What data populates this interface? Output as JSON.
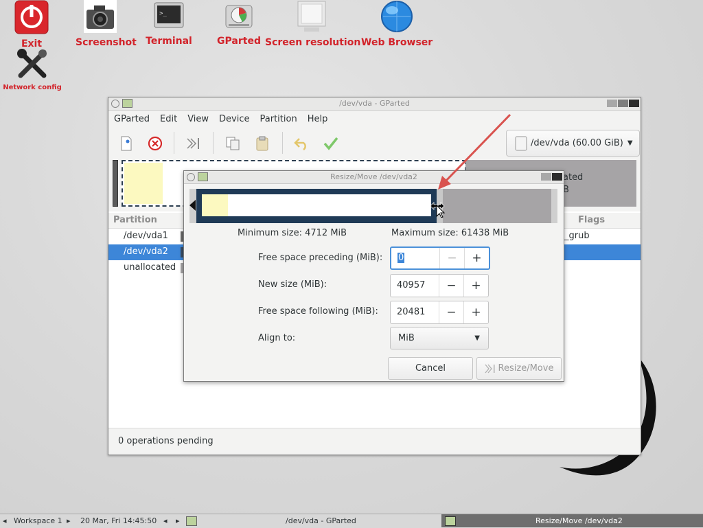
{
  "desktop": {
    "icons": [
      {
        "label": "Exit",
        "icon": "power-icon"
      },
      {
        "label": "Screenshot",
        "icon": "camera-icon"
      },
      {
        "label": "Terminal",
        "icon": "terminal-icon"
      },
      {
        "label": "GParted",
        "icon": "disk-icon"
      },
      {
        "label": "Screen resolution",
        "icon": "monitor-icon"
      },
      {
        "label": "Web Browser",
        "icon": "globe-icon"
      },
      {
        "label": "Network config",
        "icon": "tools-icon"
      }
    ]
  },
  "main_window": {
    "title": "/dev/vda - GParted",
    "menu": [
      "GParted",
      "Edit",
      "View",
      "Device",
      "Partition",
      "Help"
    ],
    "device_selector": "/dev/vda (60.00 GiB)",
    "disk_map_partial_label": "ated",
    "disk_map_partial_size": "B",
    "columns": {
      "partition": "Partition",
      "flags": "Flags"
    },
    "rows": [
      {
        "name": "/dev/vda1",
        "flags": "_grub",
        "selected": false
      },
      {
        "name": "/dev/vda2",
        "flags": "",
        "selected": true
      },
      {
        "name": "unallocated",
        "flags": "",
        "selected": false
      }
    ],
    "status": "0 operations pending"
  },
  "dialog": {
    "title": "Resize/Move /dev/vda2",
    "min_size": "Minimum size: 4712 MiB",
    "max_size": "Maximum size: 61438 MiB",
    "fields": [
      {
        "label": "Free space preceding (MiB):",
        "value": "0"
      },
      {
        "label": "New size (MiB):",
        "value": "40957"
      },
      {
        "label": "Free space following (MiB):",
        "value": "20481"
      }
    ],
    "align_label": "Align to:",
    "align_value": "MiB",
    "cancel": "Cancel",
    "resize_move": "Resize/Move",
    "spin_minus": "−",
    "spin_plus": "+"
  },
  "taskbar": {
    "workspace": "Workspace 1",
    "datetime": "20 Mar, Fri 14:45:50",
    "task1": "/dev/vda - GParted",
    "task2": "Resize/Move /dev/vda2"
  },
  "colors": {
    "accent": "#4a90d9",
    "brand_red": "#d2232a",
    "partition_dark": "#1f3a56",
    "partition_used": "#fcf9c0"
  }
}
